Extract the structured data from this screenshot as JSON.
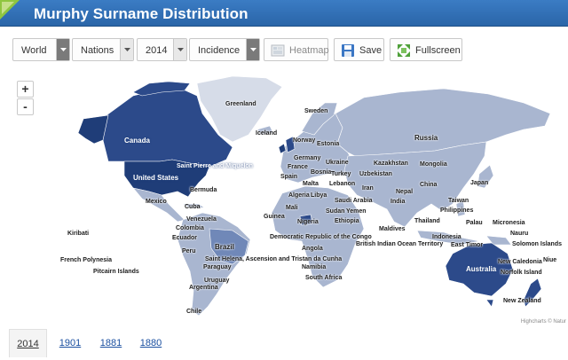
{
  "header": {
    "title": "Murphy Surname Distribution",
    "brand_color": "#2a65a8"
  },
  "toolbar": {
    "region_select": "World",
    "level_select": "Nations",
    "year_select": "2014",
    "measure_select": "Incidence",
    "heatmap_label": "Heatmap",
    "save_label": "Save",
    "fullscreen_label": "Fullscreen"
  },
  "map": {
    "zoom_in": "+",
    "zoom_out": "-",
    "credits": "Highcharts © Natur",
    "colors": {
      "ocean": "#ffffff",
      "low": "#a9b6d0",
      "lighter": "#d6dce8",
      "medium": "#7088b8",
      "high": "#2c4a8a",
      "highest": "#1f3d78"
    },
    "labels": {
      "greenland": "Greenland",
      "iceland": "Iceland",
      "sweden": "Sweden",
      "norway": "Norway",
      "estonia": "Estonia",
      "russia": "Russia",
      "canada": "Canada",
      "germany": "Germany",
      "ukraine": "Ukraine",
      "kazakhstan": "Kazakhstan",
      "mongolia": "Mongolia",
      "spm": "Saint Pierre and Miquelon",
      "france": "France",
      "bosnia": "Bosnia",
      "turkey": "Turkey",
      "uzbekistan": "Uzbekistan",
      "united_states": "United States",
      "spain": "Spain",
      "lebanon": "Lebanon",
      "china": "China",
      "japan": "Japan",
      "iran": "Iran",
      "bermuda": "Bermuda",
      "malta": "Malta",
      "algeria": "Algeria",
      "libya": "Libya",
      "saudi_arabia": "Saudi Arabia",
      "nepal": "Nepal",
      "india": "India",
      "taiwan": "Taiwan",
      "mexico": "Mexico",
      "cuba": "Cuba",
      "mali": "Mali",
      "sudan": "Sudan",
      "yemen": "Yemen",
      "philippines": "Philippines",
      "venezuela": "Venezuela",
      "guinea": "Guinea",
      "nigeria": "Nigeria",
      "ethiopia": "Ethiopia",
      "thailand": "Thailand",
      "palau": "Palau",
      "micronesia": "Micronesia",
      "colombia": "Colombia",
      "maldives": "Maldives",
      "nauru": "Nauru",
      "kiribati": "Kiribati",
      "ecuador": "Ecuador",
      "drc": "Democratic Republic of the Congo",
      "indonesia": "Indonesia",
      "biot": "British Indian Ocean Territory",
      "solomon": "Solomon Islands",
      "brazil": "Brazil",
      "angola": "Angola",
      "peru": "Peru",
      "east_timor": "East Timor",
      "french_polynesia": "French Polynesia",
      "st_helena": "Saint Helena, Ascension and Tristan da Cunha",
      "australia": "Australia",
      "new_caledonia": "New Caledonia",
      "niue": "Niue",
      "paraguay": "Paraguay",
      "namibia": "Namibia",
      "norfolk": "Norfolk Island",
      "pitcairn": "Pitcairn Islands",
      "uruguay": "Uruguay",
      "south_africa": "South Africa",
      "argentina": "Argentina",
      "new_zealand": "New Zealand",
      "chile": "Chile"
    }
  },
  "tabs": [
    "2014",
    "1901",
    "1881",
    "1880"
  ]
}
